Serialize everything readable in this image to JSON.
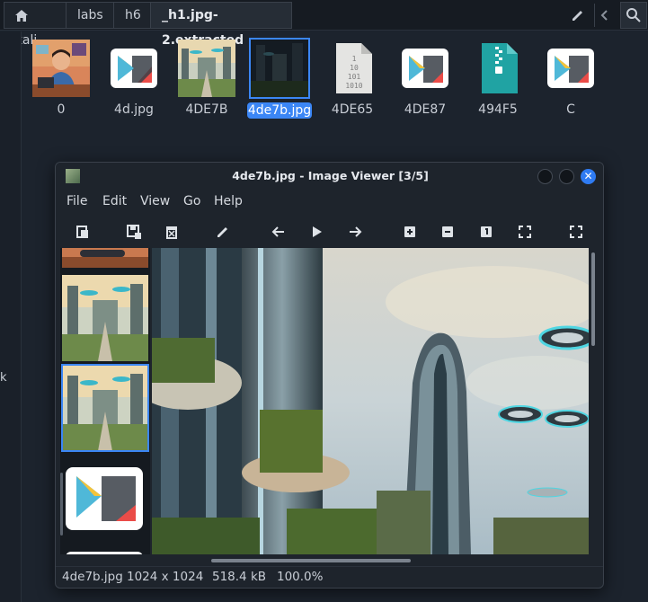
{
  "pathbar": {
    "crumbs": [
      "kali",
      "labs",
      "h6",
      "_h1.jpg-2.extracted"
    ],
    "edit_icon": "pencil-icon",
    "search_icon": "search-icon"
  },
  "sidebar": {
    "partial_text": "k"
  },
  "files": [
    {
      "name": "0",
      "kind": "image-portrait"
    },
    {
      "name": "4d.jpg",
      "kind": "media-file"
    },
    {
      "name": "4DE7B",
      "kind": "image-city"
    },
    {
      "name": "4de7b.jpg",
      "kind": "image-city-dark",
      "selected": true
    },
    {
      "name": "4DE65",
      "kind": "binary-file"
    },
    {
      "name": "4DE87",
      "kind": "media-file"
    },
    {
      "name": "494F5",
      "kind": "archive-file"
    },
    {
      "name": "C",
      "kind": "media-file"
    }
  ],
  "viewer": {
    "title": "4de7b.jpg - Image Viewer [3/5]",
    "menu": [
      "File",
      "Edit",
      "View",
      "Go",
      "Help"
    ],
    "toolbar": [
      "open-icon",
      "save-icon",
      "delete-icon",
      "edit-icon",
      "previous-icon",
      "play-icon",
      "next-icon",
      "zoom-in-icon",
      "zoom-out-icon",
      "zoom-original-icon",
      "fit-icon",
      "fullscreen-icon"
    ],
    "status": {
      "filename": "4de7b.jpg",
      "dimensions": "1024 x 1024",
      "filesize": "518.4 kB",
      "zoom": "100.0%"
    }
  },
  "colors": {
    "accent": "#3b86f5",
    "background": "#1c232d",
    "close_button": "#2f7bf2"
  }
}
